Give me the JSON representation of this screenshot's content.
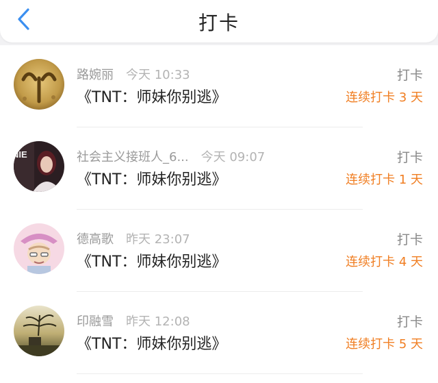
{
  "header": {
    "title": "打卡",
    "back_icon": "chevron-left-icon",
    "accent_color": "#3b8ff0"
  },
  "records": [
    {
      "user": "路婉丽",
      "time": "今天 10:33",
      "work": "《TNT：师妹你别逃》",
      "type": "打卡",
      "streak": "连续打卡 3 天"
    },
    {
      "user": "社会主义接班人_6...",
      "time": "今天 09:07",
      "work": "《TNT：师妹你别逃》",
      "type": "打卡",
      "streak": "连续打卡 1 天"
    },
    {
      "user": "德高歌",
      "time": "昨天 23:07",
      "work": "《TNT：师妹你别逃》",
      "type": "打卡",
      "streak": "连续打卡 4 天"
    },
    {
      "user": "印融雪",
      "time": "昨天 12:08",
      "work": "《TNT：师妹你别逃》",
      "type": "打卡",
      "streak": "连续打卡 5 天"
    }
  ],
  "colors": {
    "streak": "#f07e22",
    "name": "#9a9a9a",
    "title": "#222222"
  }
}
